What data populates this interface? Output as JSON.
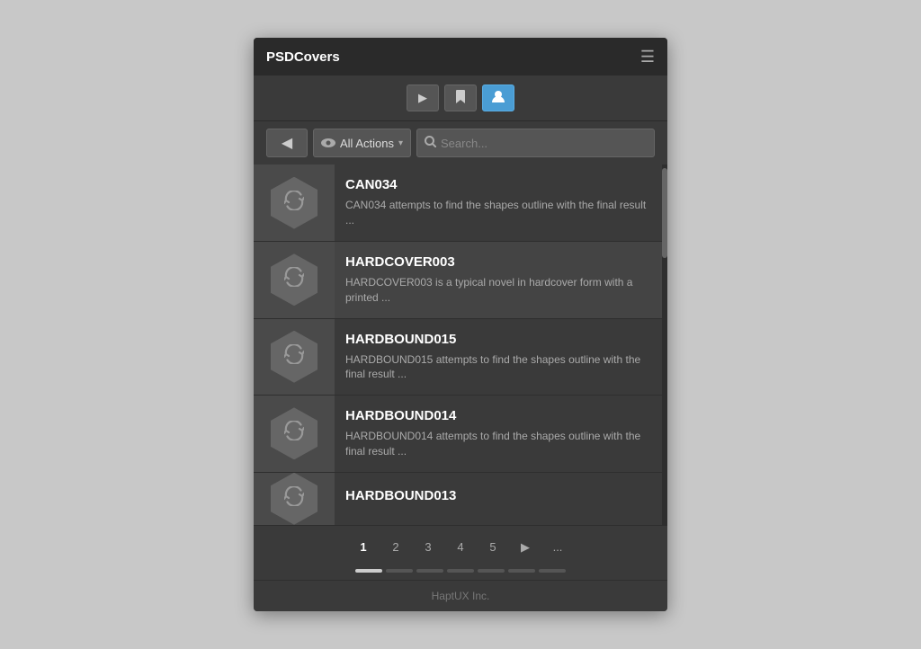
{
  "header": {
    "title": "PSDCovers",
    "hamburger": "☰"
  },
  "toolbar": {
    "play_label": "▶",
    "bookmark_label": "🔖",
    "user_label": "👤"
  },
  "searchbar": {
    "back_label": "◀",
    "filter_label": "All Actions",
    "filter_arrow": "▾",
    "search_placeholder": "Search..."
  },
  "items": [
    {
      "id": "CAN034",
      "title": "CAN034",
      "description": "CAN034 attempts to find the shapes outline with the final result ..."
    },
    {
      "id": "HARDCOVER003",
      "title": "HARDCOVER003",
      "description": "HARDCOVER003 is a typical novel in hardcover form with a printed ..."
    },
    {
      "id": "HARDBOUND015",
      "title": "HARDBOUND015",
      "description": "HARDBOUND015 attempts to find the shapes outline with the final result ..."
    },
    {
      "id": "HARDBOUND014",
      "title": "HARDBOUND014",
      "description": "HARDBOUND014 attempts to find the shapes outline with the final result ..."
    },
    {
      "id": "HARDBOUND013",
      "title": "HARDBOUND013",
      "description": ""
    }
  ],
  "pagination": {
    "pages": [
      "1",
      "2",
      "3",
      "4",
      "5",
      "▶",
      "..."
    ],
    "active_page": "1"
  },
  "footer": {
    "text": "HaptUX Inc."
  }
}
